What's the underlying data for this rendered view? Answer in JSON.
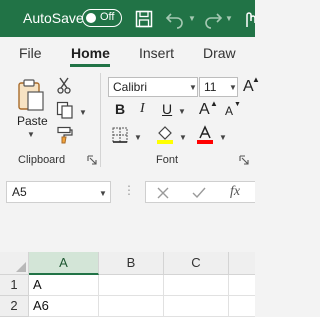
{
  "titlebar": {
    "autosave_label": "AutoSave",
    "autosave_state": "Off",
    "bg_color": "#217346",
    "icons": [
      "save-icon",
      "undo-icon",
      "redo-icon"
    ]
  },
  "tabs": [
    {
      "label": "File",
      "active": false
    },
    {
      "label": "Home",
      "active": true
    },
    {
      "label": "Insert",
      "active": false
    },
    {
      "label": "Draw",
      "active": false
    }
  ],
  "ribbon": {
    "clipboard": {
      "paste_label": "Paste",
      "group_label": "Clipboard",
      "icons": [
        "paste-icon",
        "cut-icon",
        "copy-icon",
        "format-painter-icon"
      ]
    },
    "font": {
      "font_name": "Calibri",
      "font_size": "11",
      "grow_label": "A",
      "shrink_label": "A",
      "bold_label": "B",
      "italic_label": "I",
      "underline_label": "U",
      "group_label": "Font",
      "fill_color": "#ffff00",
      "font_color": "#ff0000"
    }
  },
  "formula_bar": {
    "name_box": "A5",
    "fx_label": "fx",
    "formula_value": ""
  },
  "grid": {
    "columns": [
      "A",
      "B",
      "C"
    ],
    "selected_column": "A",
    "rows": [
      {
        "num": "1",
        "A": "A",
        "B": "",
        "C": ""
      },
      {
        "num": "2",
        "A": "A6",
        "B": "",
        "C": ""
      }
    ]
  }
}
